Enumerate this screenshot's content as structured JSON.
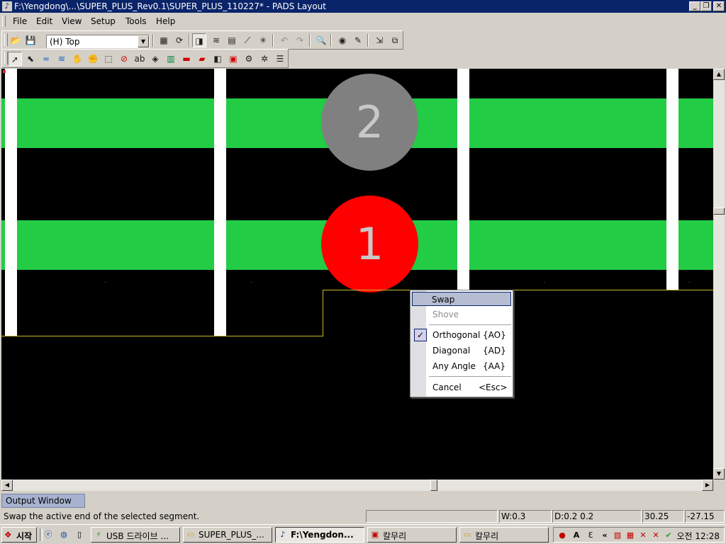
{
  "window": {
    "title": "F:\\Yengdong\\...\\SUPER_PLUS_Rev0.1\\SUPER_PLUS_110227* - PADS Layout",
    "app_icon": "pads-icon"
  },
  "menu": {
    "items": [
      {
        "label": "File"
      },
      {
        "label": "Edit"
      },
      {
        "label": "View"
      },
      {
        "label": "Setup"
      },
      {
        "label": "Tools"
      },
      {
        "label": "Help"
      }
    ]
  },
  "toolbar": {
    "layer_select_value": "(H) Top"
  },
  "canvas": {
    "background": "#000000",
    "trace_color": "#22cc44",
    "pads": [
      {
        "label": "2",
        "color": "#808080"
      },
      {
        "label": "1",
        "color": "#ff0000"
      }
    ]
  },
  "context_menu": {
    "items": [
      {
        "label": "Swap",
        "shortcut": "",
        "state": "highlighted"
      },
      {
        "label": "Shove",
        "shortcut": "",
        "state": "disabled"
      },
      {
        "label": "Orthogonal",
        "shortcut": "{AO}",
        "state": "checked"
      },
      {
        "label": "Diagonal",
        "shortcut": "{AD}",
        "state": "normal"
      },
      {
        "label": "Any Angle",
        "shortcut": "{AA}",
        "state": "normal"
      },
      {
        "label": "Cancel",
        "shortcut": "<Esc>",
        "state": "normal"
      }
    ]
  },
  "output_window": {
    "tab_label": "Output Window"
  },
  "status": {
    "message": "Swap the active end of the selected segment.",
    "width": "W:0.3",
    "delta": "D:0.2 0.2",
    "x": "30.25",
    "y": "-27.15"
  },
  "taskbar": {
    "start_label": "시작",
    "buttons": [
      {
        "label": "USB 드라이브 ...",
        "icon": "usb-drive-icon"
      },
      {
        "label": "SUPER_PLUS_...",
        "icon": "folder-icon"
      },
      {
        "label": "F:\\Yengdon...",
        "icon": "pads-icon",
        "active": true
      },
      {
        "label": "칼무리",
        "icon": "app-icon"
      },
      {
        "label": "칼무리",
        "icon": "folder-icon"
      }
    ],
    "clock": "오전 12:28"
  }
}
